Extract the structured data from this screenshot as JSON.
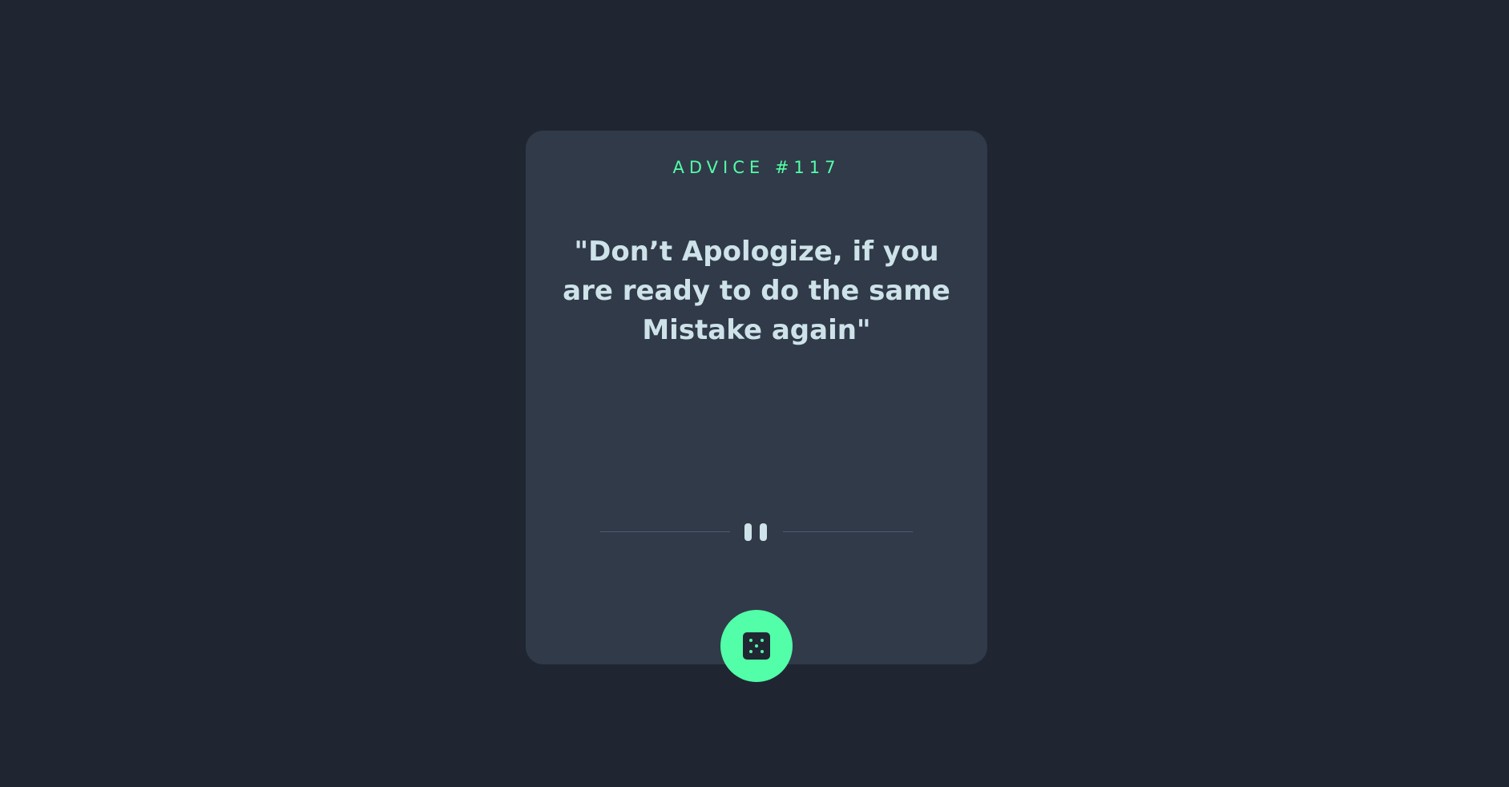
{
  "card": {
    "advice_id": "ADVICE #117",
    "quote": "\"Don’t Apologize, if you are ready to do the same Mistake again\""
  },
  "actions": {
    "generate_icon": "dice-icon"
  },
  "colors": {
    "background": "#1f2632",
    "card": "#313a49",
    "accent": "#52ffa8",
    "text": "#cee3e9",
    "divider": "#4e5d73"
  }
}
